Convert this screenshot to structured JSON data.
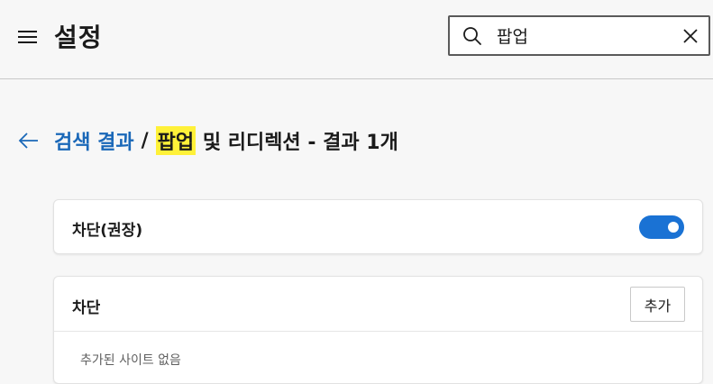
{
  "header": {
    "menu_icon": "hamburger-menu-icon",
    "title": "설정",
    "search": {
      "icon": "search-icon",
      "value": "팝업",
      "clear_icon": "close-icon"
    }
  },
  "breadcrumb": {
    "back_icon": "arrow-left-icon",
    "link": "검색 결과",
    "separator": "/",
    "highlight": "팝업",
    "rest": " 및 리디렉션 - 결과 1개"
  },
  "block_recommended": {
    "label": "차단(권장)",
    "toggle_on": true
  },
  "block_list": {
    "label": "차단",
    "add_label": "추가",
    "empty_text": "추가된 사이트 없음"
  },
  "colors": {
    "accent": "#1a72d4",
    "link": "#1a68b8",
    "highlight": "#fff139"
  }
}
